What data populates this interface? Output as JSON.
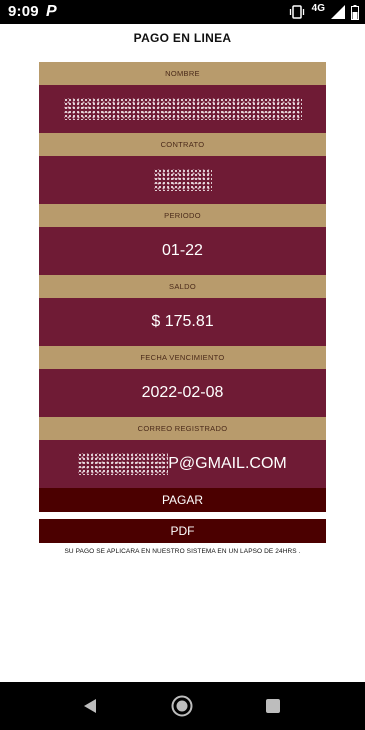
{
  "status_bar": {
    "time": "9:09",
    "app_icon": "P",
    "network": "4G",
    "icons": [
      "vibrate-icon",
      "signal-icon",
      "battery-icon"
    ]
  },
  "page": {
    "title": "PAGO EN LINEA"
  },
  "fields": {
    "nombre": {
      "label": "NOMBRE",
      "value": ""
    },
    "contrato": {
      "label": "CONTRATO",
      "value": ""
    },
    "periodo": {
      "label": "PERIODO",
      "value": "01-22"
    },
    "saldo": {
      "label": "SALDO",
      "value": "$ 175.81"
    },
    "fecha_vencimiento": {
      "label": "FECHA VENCIMIENTO",
      "value": "2022-02-08"
    },
    "correo": {
      "label": "CORREO REGISTRADO",
      "value_visible_suffix": "P@GMAIL.COM"
    }
  },
  "buttons": {
    "pagar": "PAGAR",
    "pdf": "PDF"
  },
  "notice": "SU PAGO SE APLICARA EN NUESTRO SISTEMA EN UN LAPSO DE 24HRS .",
  "colors": {
    "label_bg": "#b89b6c",
    "value_bg": "#6f1b35",
    "button_bg": "#4b0000"
  },
  "nav_bar": {
    "icons": [
      "back-icon",
      "home-icon",
      "recents-icon"
    ]
  }
}
